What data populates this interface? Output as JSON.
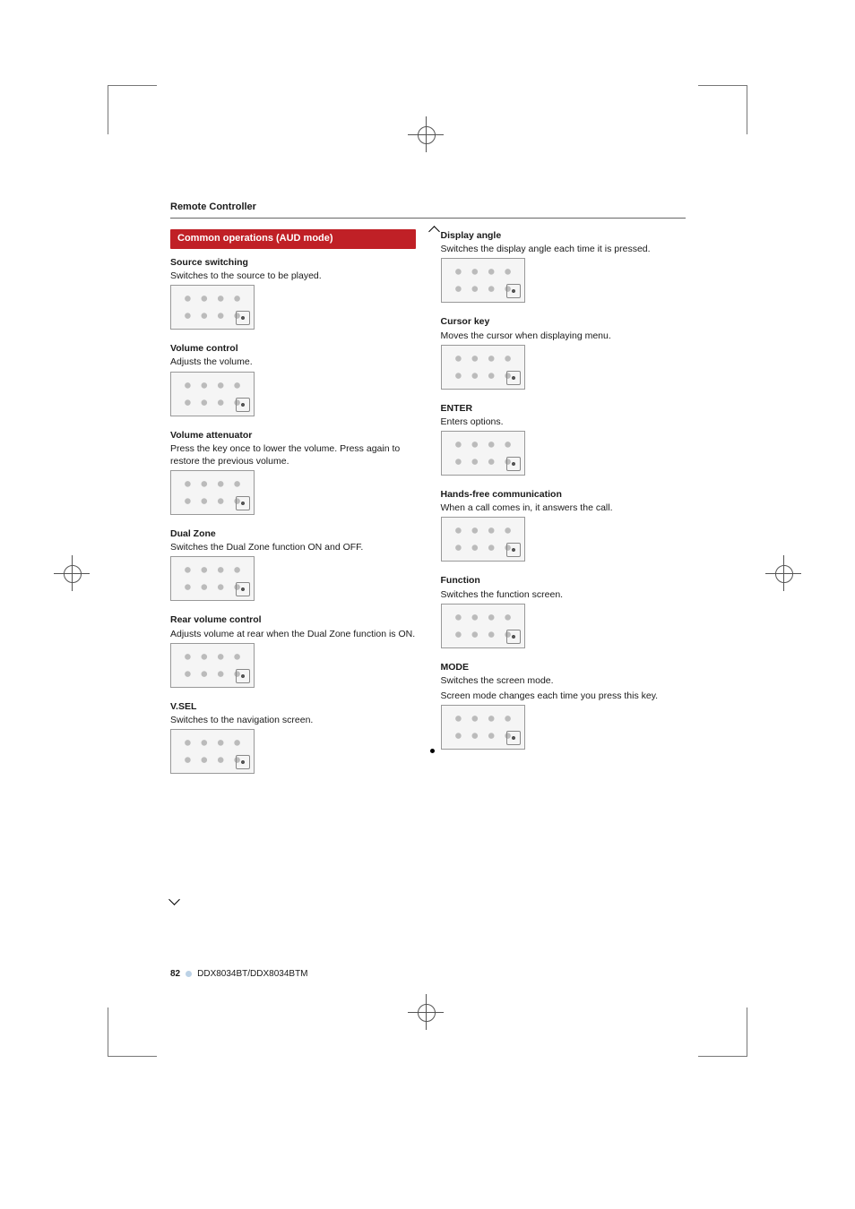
{
  "header": "Remote Controller",
  "left": {
    "bar": "Common operations (AUD mode)",
    "sections": [
      {
        "title": "Source switching",
        "body": "Switches to the source to be played."
      },
      {
        "title": "Volume control",
        "body": "Adjusts the volume."
      },
      {
        "title": "Volume attenuator",
        "body": "Press the key once to lower the volume. Press again to restore the previous volume."
      },
      {
        "title": "Dual Zone",
        "body": "Switches the Dual Zone function ON and OFF."
      },
      {
        "title": "Rear volume control",
        "body": "Adjusts volume at rear when the Dual Zone function is ON."
      },
      {
        "title": "V.SEL",
        "body": "Switches to the navigation screen."
      }
    ]
  },
  "right": {
    "sections": [
      {
        "title": "Display angle",
        "body": "Switches the display angle each time it is pressed."
      },
      {
        "title": "Cursor key",
        "body": "Moves the cursor when displaying menu."
      },
      {
        "title": "ENTER",
        "body": "Enters options."
      },
      {
        "title": "Hands-free communication",
        "body": "When a call comes in, it answers the call."
      },
      {
        "title": "Function",
        "body": "Switches the function screen."
      },
      {
        "title": "MODE",
        "body": "Switches the screen mode.",
        "body2": "Screen mode changes each time you press this key."
      }
    ]
  },
  "footer": {
    "page": "82",
    "model": "DDX8034BT/DDX8034BTM"
  }
}
